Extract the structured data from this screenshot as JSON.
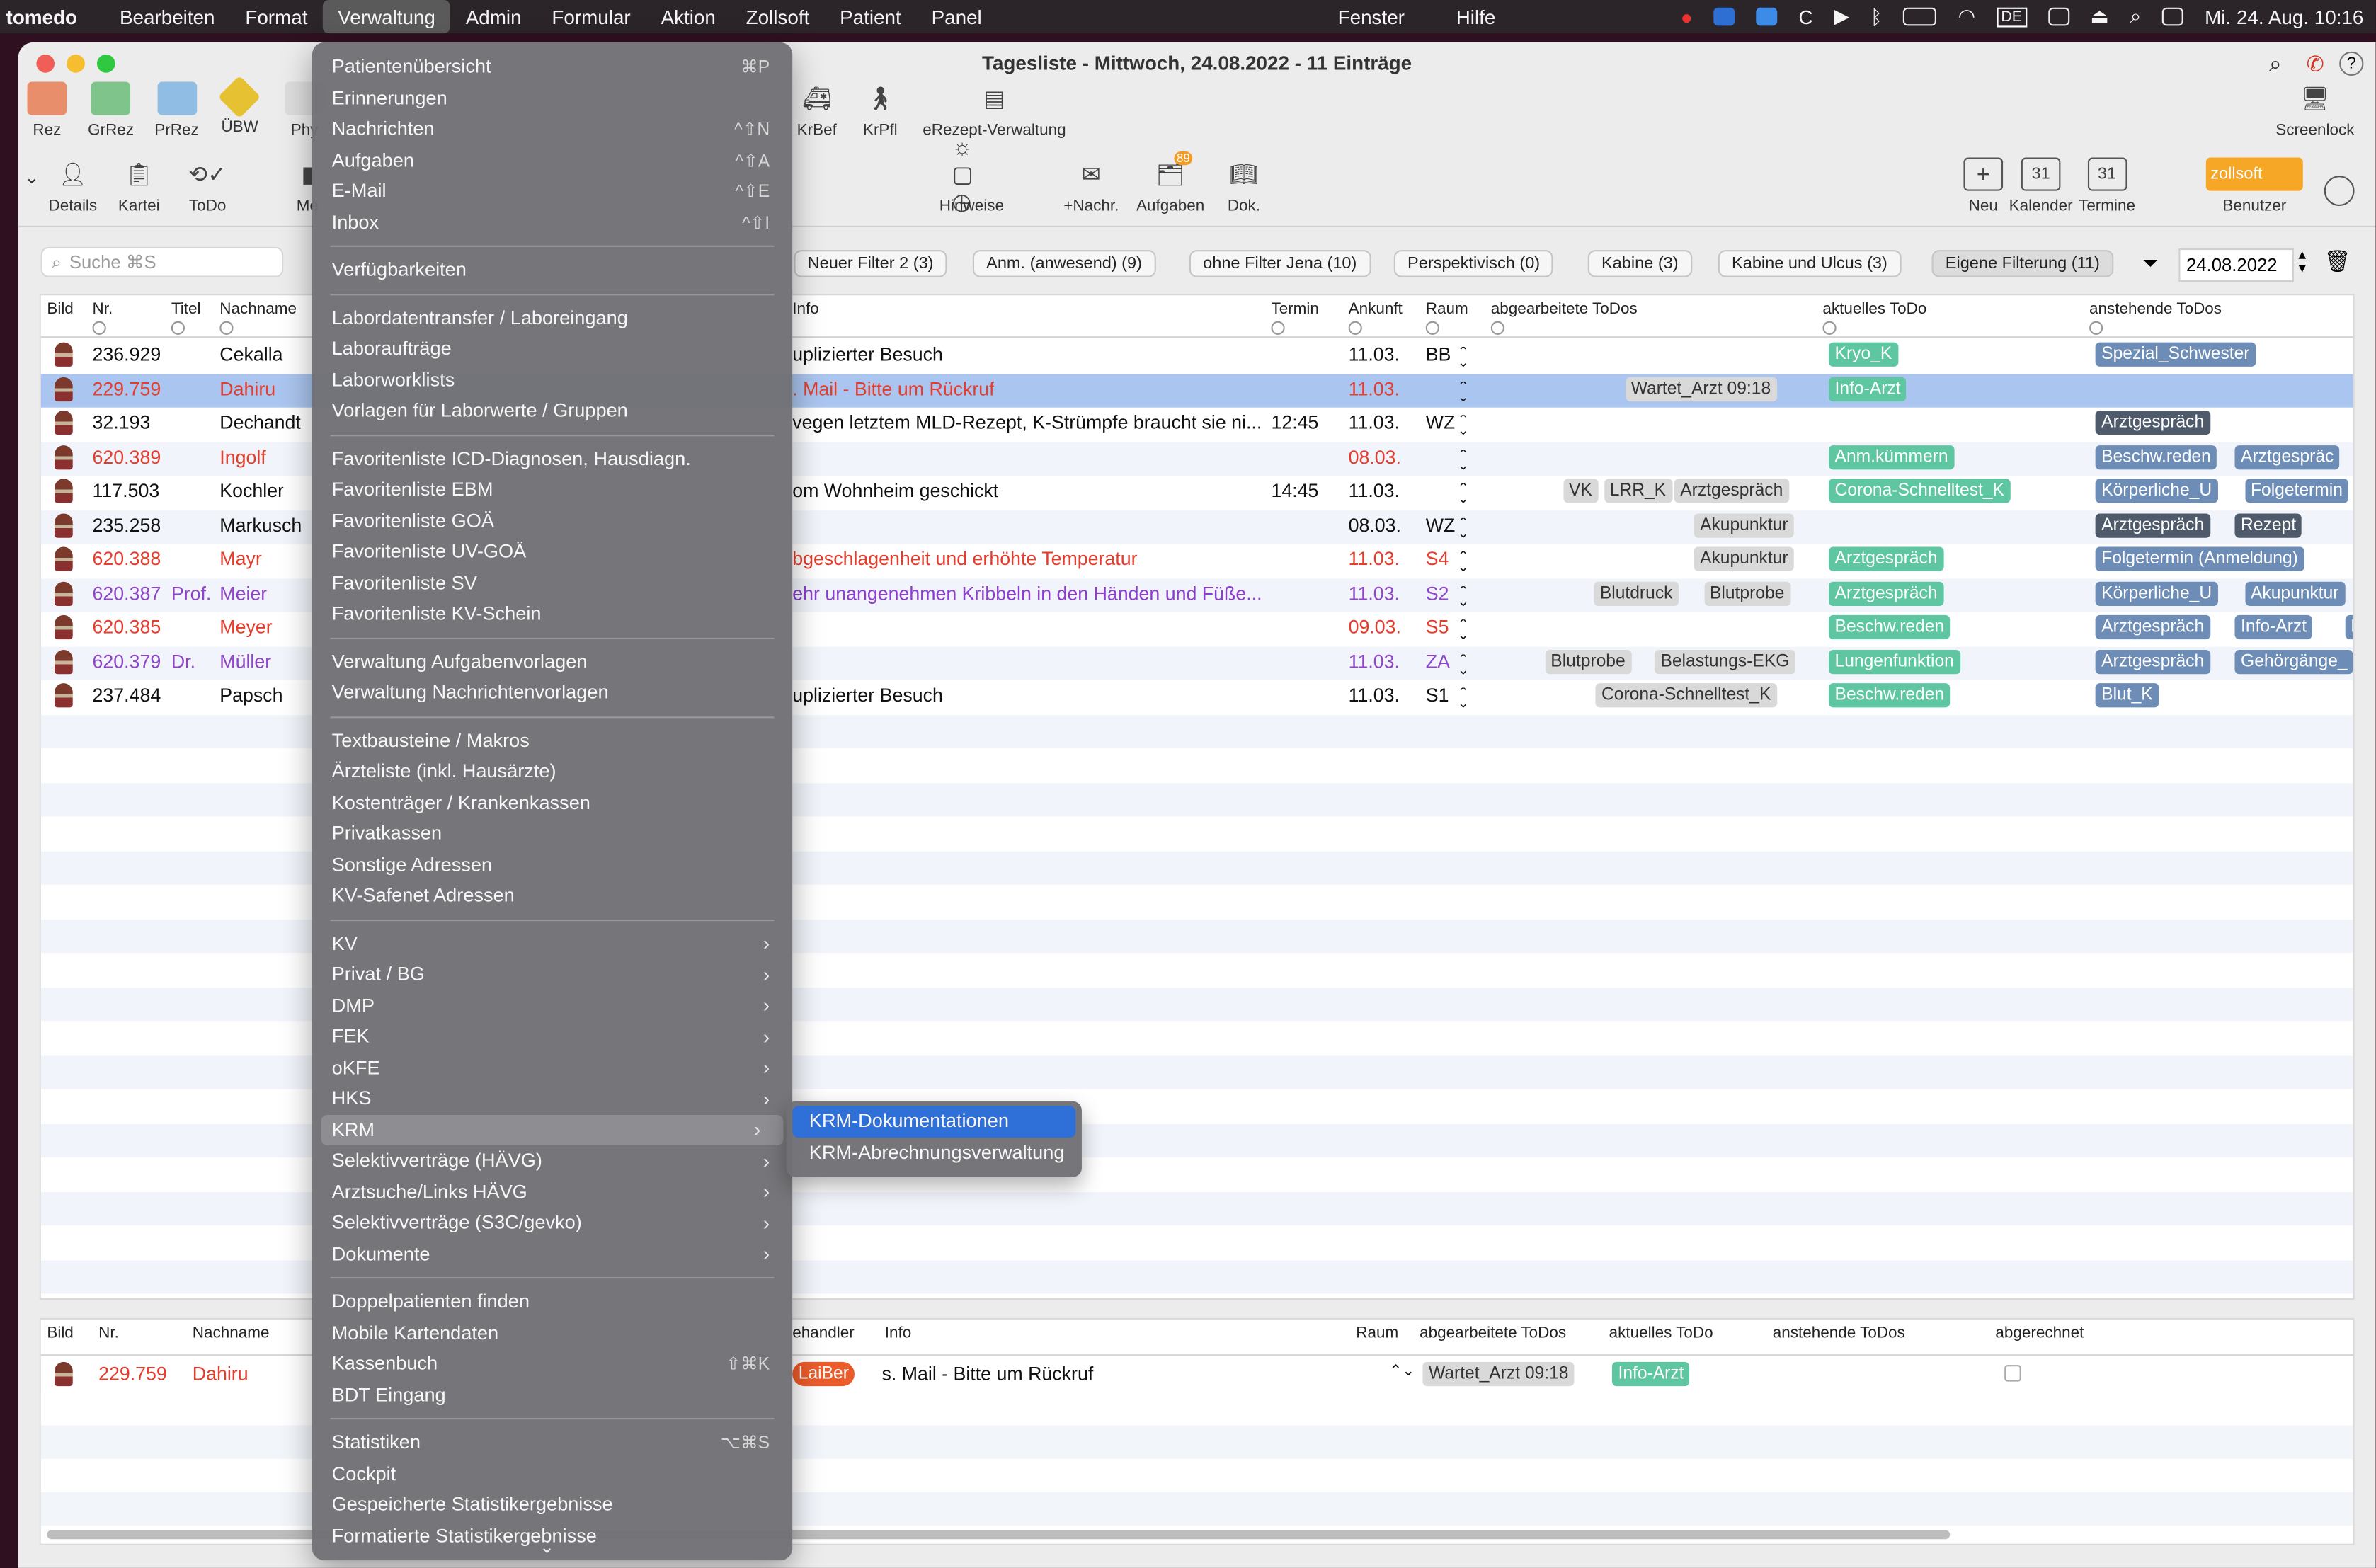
{
  "menubar": {
    "app": "tomedo",
    "items": [
      "Bearbeiten",
      "Format",
      "Verwaltung",
      "Admin",
      "Formular",
      "Aktion",
      "Zollsoft",
      "Patient",
      "Panel"
    ],
    "right_items": [
      "Fenster",
      "Hilfe"
    ],
    "keyboard_layout": "DE",
    "clock": "Mi. 24. Aug.  10:16"
  },
  "window": {
    "title": "Tagesliste - Mittwoch, 24.08.2022 - 11 Einträge"
  },
  "toolbar": {
    "row1": [
      "Rez",
      "GrRez",
      "PrRez",
      "ÜBW",
      "Phy",
      "KrBef",
      "KrPfl",
      "eRezept-Verwaltung",
      "Screenlock"
    ],
    "row2": [
      "Details",
      "Kartei",
      "ToDo",
      "Me",
      "Hinweise",
      "+Nachr.",
      "Aufgaben",
      "Dok.",
      "Neu",
      "Kalender",
      "Termine",
      "Benutzer"
    ],
    "zollsoft_label": "zollsoft",
    "aufgaben_badge": "89",
    "calendar_day": "31"
  },
  "search": {
    "placeholder": "Suche ⌘S"
  },
  "filters": {
    "tabs": [
      "Neuer Filter 2 (3)",
      "Anm. (anwesend) (9)",
      "ohne Filter Jena (10)",
      "Perspektivisch (0)",
      "Kabine (3)",
      "Kabine und Ulcus (3)",
      "Eigene Filterung (11)"
    ],
    "date": "24.08.2022"
  },
  "main_table": {
    "headers": [
      "Bild",
      "Nr.",
      "Titel",
      "Nachname",
      "Info",
      "Termin",
      "Ankunft",
      "Raum",
      "abgearbeitete ToDos",
      "aktuelles ToDo",
      "anstehende ToDos"
    ],
    "rows": [
      {
        "nr": "236.929",
        "titel": "",
        "name": "Cekalla",
        "info": "uplizierter Besuch",
        "termin": "",
        "ankunft": "11.03.",
        "raum": "BB",
        "done": [],
        "current": [
          "Kryo_K"
        ],
        "next": [
          "Spezial_Schwester"
        ],
        "style": "normal"
      },
      {
        "nr": "229.759",
        "titel": "",
        "name": "Dahiru",
        "info": ". Mail -  Bitte um Rückruf",
        "termin": "",
        "ankunft": "11.03.",
        "raum": "",
        "done": [
          "Wartet_Arzt 09:18"
        ],
        "current": [
          "Info-Arzt"
        ],
        "next": [],
        "style": "sel"
      },
      {
        "nr": "32.193",
        "titel": "",
        "name": "Dechandt",
        "info": "vegen letztem MLD-Rezept, K-Strümpfe braucht sie ni...",
        "termin": "12:45",
        "ankunft": "11.03.",
        "raum": "WZ",
        "done": [],
        "current": [],
        "next": [
          "Arztgespräch"
        ],
        "style": "normal"
      },
      {
        "nr": "620.389",
        "titel": "",
        "name": "Ingolf",
        "info": "",
        "termin": "",
        "ankunft": "08.03.",
        "raum": "",
        "done": [],
        "current": [
          "Anm.kümmern"
        ],
        "next": [
          "Beschw.reden",
          "Arztgespräc"
        ],
        "style": "red"
      },
      {
        "nr": "117.503",
        "titel": "",
        "name": "Kochler",
        "info": "om Wohnheim geschickt",
        "termin": "14:45",
        "ankunft": "11.03.",
        "raum": "",
        "done": [
          "VK",
          "LRR_K",
          "Arztgespräch"
        ],
        "current": [
          "Corona-Schnelltest_K"
        ],
        "next": [
          "Körperliche_U",
          "Folgetermin"
        ],
        "style": "normal"
      },
      {
        "nr": "235.258",
        "titel": "",
        "name": "Markusch",
        "info": "",
        "termin": "",
        "ankunft": "08.03.",
        "raum": "WZ",
        "done": [
          "Akupunktur"
        ],
        "current": [],
        "next": [
          "Arztgespräch",
          "Rezept"
        ],
        "style": "normal"
      },
      {
        "nr": "620.388",
        "titel": "",
        "name": "Mayr",
        "info": "bgeschlagenheit und erhöhte Temperatur",
        "termin": "",
        "ankunft": "11.03.",
        "raum": "S4",
        "done": [
          "Akupunktur"
        ],
        "current": [
          "Arztgespräch"
        ],
        "next": [
          "Folgetermin (Anmeldung)"
        ],
        "style": "red"
      },
      {
        "nr": "620.387",
        "titel": "Prof.",
        "name": "Meier",
        "info": "ehr unangenehmen Kribbeln in den Händen und Füße...",
        "termin": "",
        "ankunft": "11.03.",
        "raum": "S2",
        "done": [
          "Blutdruck",
          "Blutprobe"
        ],
        "current": [
          "Arztgespräch"
        ],
        "next": [
          "Körperliche_U",
          "Akupunktur"
        ],
        "style": "purple"
      },
      {
        "nr": "620.385",
        "titel": "",
        "name": "Meyer",
        "info": "",
        "termin": "",
        "ankunft": "09.03.",
        "raum": "S5",
        "done": [],
        "current": [
          "Beschw.reden"
        ],
        "next": [
          "Arztgespräch",
          "Info-Arzt",
          "R"
        ],
        "style": "red"
      },
      {
        "nr": "620.379",
        "titel": "Dr.",
        "name": "Müller",
        "info": "",
        "termin": "",
        "ankunft": "11.03.",
        "raum": "ZA",
        "done": [
          "Blutprobe",
          "Belastungs-EKG"
        ],
        "current": [
          "Lungenfunktion"
        ],
        "next": [
          "Arztgespräch",
          "Gehörgänge_"
        ],
        "style": "purple"
      },
      {
        "nr": "237.484",
        "titel": "",
        "name": "Papsch",
        "info": "uplizierter Besuch",
        "termin": "",
        "ankunft": "11.03.",
        "raum": "S1",
        "done": [
          "Corona-Schnelltest_K"
        ],
        "current": [
          "Beschw.reden"
        ],
        "next": [
          "Blut_K"
        ],
        "style": "normal"
      }
    ]
  },
  "lower_table": {
    "headers": [
      "Bild",
      "Nr.",
      "Nachname",
      "ehandler",
      "Info",
      "Raum",
      "abgearbeitete ToDos",
      "aktuelles ToDo",
      "anstehende ToDos",
      "abgerechnet"
    ],
    "row": {
      "nr": "229.759",
      "name": "Dahiru",
      "behandler": "LaiBer",
      "info": "s. Mail -  Bitte um Rückruf",
      "done": "Wartet_Arzt 09:18",
      "current": "Info-Arzt"
    }
  },
  "menu": {
    "items": [
      {
        "label": "Patientenübersicht",
        "sc": "⌘P"
      },
      {
        "label": "Erinnerungen",
        "sc": ""
      },
      {
        "label": "Nachrichten",
        "sc": "^⇧N"
      },
      {
        "label": "Aufgaben",
        "sc": "^⇧A"
      },
      {
        "label": "E-Mail",
        "sc": "^⇧E"
      },
      {
        "label": "Inbox",
        "sc": "^⇧I"
      },
      {
        "sep": true
      },
      {
        "label": "Verfügbarkeiten",
        "sc": ""
      },
      {
        "sep": true
      },
      {
        "label": "Labordatentransfer / Laboreingang",
        "sc": ""
      },
      {
        "label": "Laboraufträge",
        "sc": ""
      },
      {
        "label": "Laborworklists",
        "sc": ""
      },
      {
        "label": "Vorlagen für Laborwerte / Gruppen",
        "sc": ""
      },
      {
        "sep": true
      },
      {
        "label": "Favoritenliste ICD-Diagnosen, Hausdiagn.",
        "sc": ""
      },
      {
        "label": "Favoritenliste EBM",
        "sc": ""
      },
      {
        "label": "Favoritenliste GOÄ",
        "sc": ""
      },
      {
        "label": "Favoritenliste UV-GOÄ",
        "sc": ""
      },
      {
        "label": "Favoritenliste SV",
        "sc": ""
      },
      {
        "label": "Favoritenliste KV-Schein",
        "sc": ""
      },
      {
        "sep": true
      },
      {
        "label": "Verwaltung Aufgabenvorlagen",
        "sc": ""
      },
      {
        "label": "Verwaltung Nachrichtenvorlagen",
        "sc": ""
      },
      {
        "sep": true
      },
      {
        "label": "Textbausteine / Makros",
        "sc": ""
      },
      {
        "label": "Ärzteliste (inkl. Hausärzte)",
        "sc": ""
      },
      {
        "label": "Kostenträger / Krankenkassen",
        "sc": ""
      },
      {
        "label": "Privatkassen",
        "sc": ""
      },
      {
        "label": "Sonstige Adressen",
        "sc": ""
      },
      {
        "label": "KV-Safenet Adressen",
        "sc": ""
      },
      {
        "sep": true
      },
      {
        "label": "KV",
        "sub": true
      },
      {
        "label": "Privat / BG",
        "sub": true
      },
      {
        "label": "DMP",
        "sub": true
      },
      {
        "label": "FEK",
        "sub": true
      },
      {
        "label": "oKFE",
        "sub": true
      },
      {
        "label": "HKS",
        "sub": true
      },
      {
        "label": "KRM",
        "sub": true,
        "highlight": true
      },
      {
        "label": "Selektivverträge (HÄVG)",
        "sub": true
      },
      {
        "label": "Arztsuche/Links HÄVG",
        "sub": true
      },
      {
        "label": "Selektivverträge (S3C/gevko)",
        "sub": true
      },
      {
        "label": "Dokumente",
        "sub": true
      },
      {
        "sep": true
      },
      {
        "label": "Doppelpatienten finden",
        "sc": ""
      },
      {
        "label": "Mobile Kartendaten",
        "sc": ""
      },
      {
        "label": "Kassenbuch",
        "sc": "⇧⌘K"
      },
      {
        "label": "BDT Eingang",
        "sc": ""
      },
      {
        "sep": true
      },
      {
        "label": "Statistiken",
        "sc": "⌥⌘S"
      },
      {
        "label": "Cockpit",
        "sc": ""
      },
      {
        "label": "Gespeicherte Statistikergebnisse",
        "sc": ""
      },
      {
        "label": "Formatierte Statistikergebnisse",
        "sc": ""
      }
    ]
  },
  "submenu": {
    "items": [
      "KRM-Dokumentationen",
      "KRM-Abrechnungsverwaltung"
    ]
  }
}
